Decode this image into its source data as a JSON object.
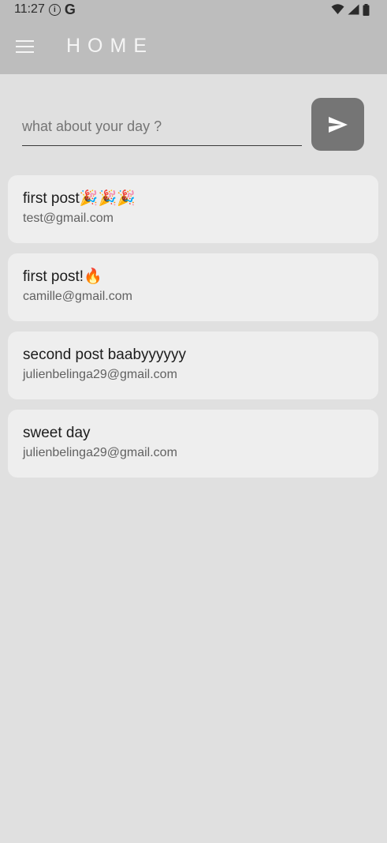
{
  "status_bar": {
    "time": "11:27",
    "icons": [
      "info-icon",
      "google-icon",
      "wifi-icon",
      "signal-icon",
      "battery-icon"
    ]
  },
  "app_bar": {
    "title": "HOME",
    "menu_icon": "hamburger-menu-icon"
  },
  "composer": {
    "placeholder": "what about your day ?",
    "value": "",
    "send_icon": "send-icon"
  },
  "posts": [
    {
      "title": "first post🎉🎉🎉",
      "email": "test@gmail.com"
    },
    {
      "title": "first post!🔥",
      "email": "camille@gmail.com"
    },
    {
      "title": "second post baabyyyyyy",
      "email": "julienbelinga29@gmail.com"
    },
    {
      "title": "sweet day",
      "email": "julienbelinga29@gmail.com"
    }
  ],
  "colors": {
    "background": "#e0e0e0",
    "app_bar": "#bdbdbd",
    "card": "#eeeeee",
    "send_button": "#757575"
  }
}
